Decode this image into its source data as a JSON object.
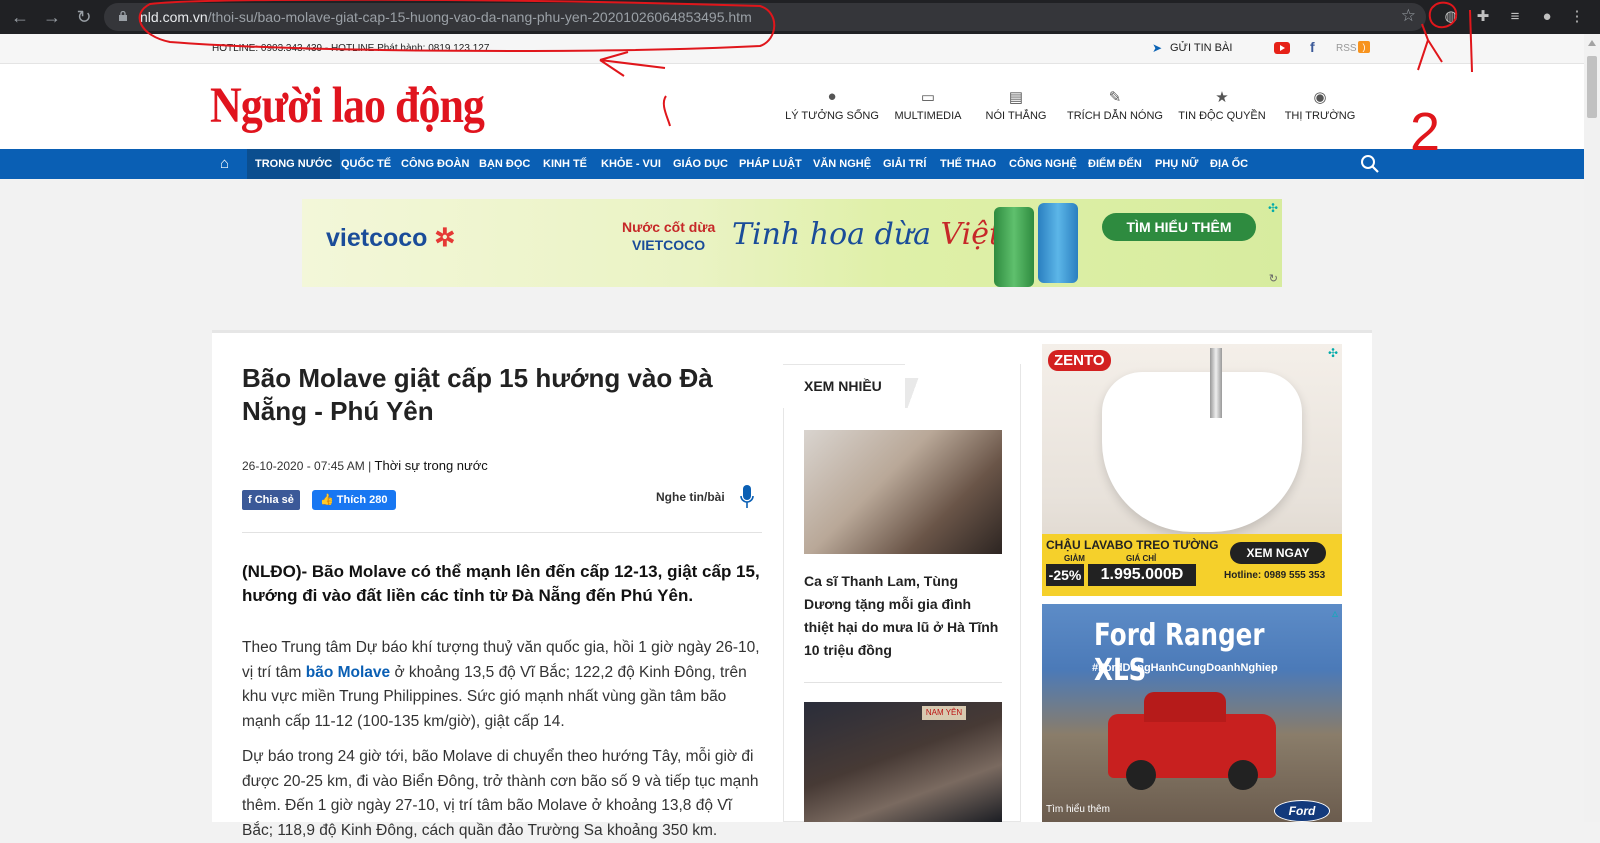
{
  "browser": {
    "url_domain": "nld.com.vn",
    "url_path": "/thoi-su/bao-molave-giat-cap-15-huong-vao-da-nang-phu-yen-20201026064853495.htm"
  },
  "topbar": {
    "hotline": "HOTLINE: 0903.343.439 - HOTLINE Phát hành: 0819.123.127",
    "submit": "GỬI TIN BÀI",
    "rss": "RSS"
  },
  "header": {
    "logo": "Người lao động",
    "nav": [
      {
        "label": "LÝ TƯỞNG SỐNG",
        "icon": "person-icon"
      },
      {
        "label": "MULTIMEDIA",
        "icon": "monitor-icon"
      },
      {
        "label": "NÓI THẲNG",
        "icon": "chat-icon"
      },
      {
        "label": "TRÍCH DẪN NÓNG",
        "icon": "microphone-icon"
      },
      {
        "label": "TIN ĐỘC QUYỀN",
        "icon": "star-icon"
      },
      {
        "label": "THỊ TRƯỜNG",
        "icon": "globe-icon"
      }
    ]
  },
  "menu": {
    "items": [
      "TRONG NƯỚC",
      "QUỐC TẾ",
      "CÔNG ĐOÀN",
      "BẠN ĐỌC",
      "KINH TẾ",
      "KHỎE - VUI",
      "GIÁO DỤC",
      "PHÁP LUẬT",
      "VĂN NGHỆ",
      "GIẢI TRÍ",
      "THỂ THAO",
      "CÔNG NGHỆ",
      "ĐIỂM ĐẾN",
      "PHỤ NỮ",
      "ĐỊA ỐC"
    ]
  },
  "banner": {
    "brand": "vietcoco",
    "line1": "Nước cốt dừa",
    "line2": "VIETCOCO",
    "slogan_a": "Tinh hoa dừa",
    "slogan_b": "Việt",
    "cta": "TÌM HIỂU THÊM"
  },
  "article": {
    "title": "Bão Molave giật cấp 15 hướng vào Đà Nẵng - Phú Yên",
    "date": "26-10-2020 - 07:45 AM",
    "category": "Thời sự trong nước",
    "share": "Chia sẻ",
    "like": "Thích 280",
    "listen": "Nghe tin/bài",
    "lead": "(NLĐO)- Bão Molave có thể mạnh lên đến cấp 12-13, giật cấp 15, hướng đi vào đất liền các tỉnh từ Đà Nẵng đến Phú Yên.",
    "p1_a": "Theo Trung tâm Dự báo khí tượng thuỷ văn quốc gia, hồi 1 giờ ngày 26-10, vị trí tâm ",
    "p1_link": "bão Molave",
    "p1_b": " ở khoảng 13,5 độ Vĩ Bắc; 122,2 độ Kinh Đông, trên khu vực miền Trung Philippines. Sức gió mạnh nhất vùng gần tâm bão mạnh cấp 11-12 (100-135 km/giờ), giật cấp 14.",
    "p2": "Dự báo trong 24 giờ tới, bão Molave di chuyển theo hướng Tây, mỗi giờ đi được 20-25 km, đi vào Biển Đông, trở thành cơn bão số 9 và tiếp tục mạnh thêm. Đến 1 giờ ngày 27-10, vị trí tâm bão Molave ở khoảng 13,8 độ Vĩ Bắc; 118,9 độ Kinh Đông, cách quần đảo Trường Sa khoảng 350 km."
  },
  "xemnhieu": {
    "tab": "XEM NHIỀU",
    "item1_title": "Ca sĩ Thanh Lam, Tùng Dương tặng mỗi gia đình thiệt hại do mưa lũ ở Hà Tĩnh 10 triệu đồng",
    "item2_sign": "NAM YÊN"
  },
  "ads": {
    "zento": "ZENTO",
    "zento_title": "CHẬU LAVABO TREO TƯỜNG",
    "zento_lbl1": "GIẢM",
    "zento_lbl2": "GIÁ CHỈ",
    "zento_disc": "-25%",
    "zento_price": "1.995.000Đ",
    "zento_btn": "XEM NGAY",
    "zento_hotline": "Hotline: 0989 555 353",
    "ford_title": "Ford Ranger XLS",
    "ford_tag": "#FordDongHanhCungDoanhNghiep",
    "ford_cta": "Tìm hiểu thêm",
    "ford_logo": "Ford"
  },
  "annotation_label": "2",
  "colors": {
    "brand_red": "#e0141e",
    "menu_blue": "#0a5fb4",
    "annotation_red": "#e0161b"
  }
}
